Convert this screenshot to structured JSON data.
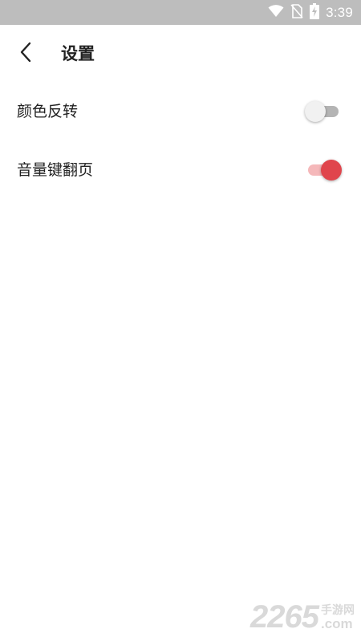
{
  "status_bar": {
    "time": "3:39",
    "icons": [
      "wifi-icon",
      "no-sim-icon",
      "battery-charging-icon"
    ],
    "background": "#bdbdbd"
  },
  "header": {
    "back_icon": "chevron-left-icon",
    "title": "设置"
  },
  "settings": [
    {
      "label": "颜色反转",
      "enabled": false
    },
    {
      "label": "音量键翻页",
      "enabled": true
    }
  ],
  "colors": {
    "accent": "#e0454c",
    "accent_track": "#f5b8ba",
    "off_track": "#b4b4b4",
    "off_thumb": "#f1f1f1"
  },
  "watermark": {
    "number": "2265",
    "cn": "手游网",
    "com": ".com"
  }
}
